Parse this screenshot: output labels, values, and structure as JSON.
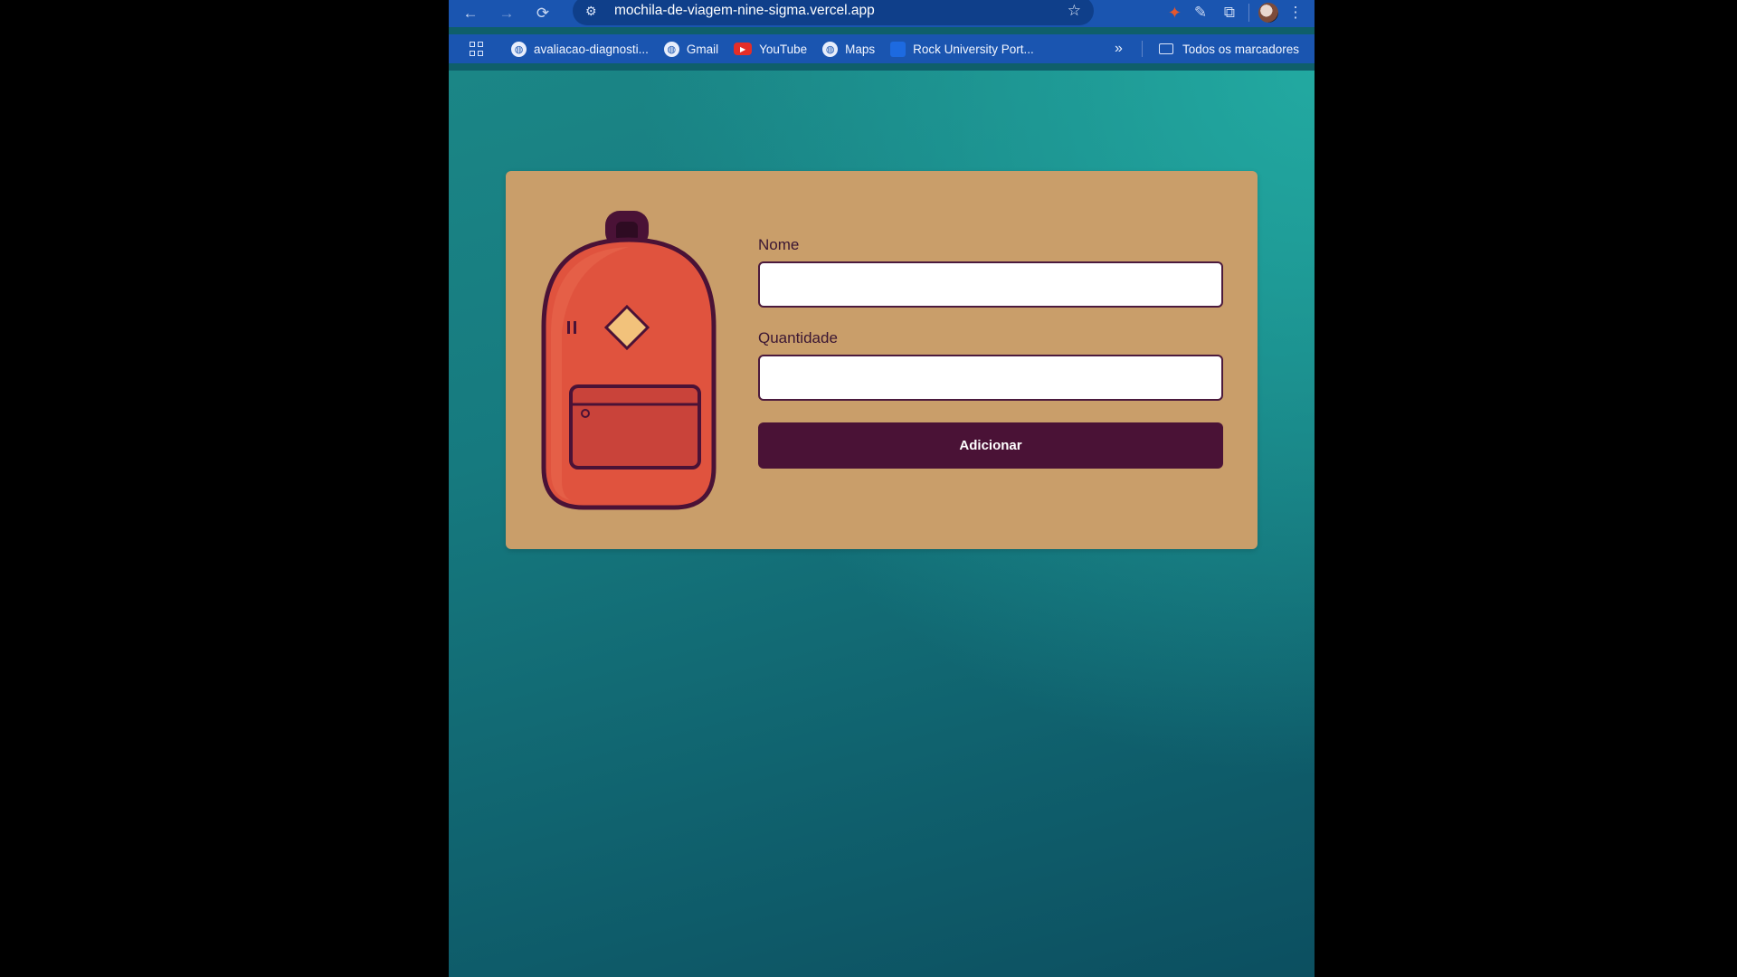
{
  "browser": {
    "url": "mochila-de-viagem-nine-sigma.vercel.app",
    "bookmarks": [
      {
        "label": "avaliacao-diagnosti...",
        "icon": "globe-icon"
      },
      {
        "label": "Gmail",
        "icon": "globe-icon"
      },
      {
        "label": "YouTube",
        "icon": "youtube-icon"
      },
      {
        "label": "Maps",
        "icon": "globe-icon"
      },
      {
        "label": "Rock University Port...",
        "icon": "rock-university-icon"
      }
    ],
    "all_bookmarks_label": "Todos os marcadores"
  },
  "form": {
    "name_label": "Nome",
    "name_value": "",
    "quantity_label": "Quantidade",
    "quantity_value": "",
    "submit_label": "Adicionar"
  },
  "colors": {
    "chrome_blue": "#1a55b0",
    "card": "#c99e6a",
    "button": "#4a1236",
    "backpack": "#e0533e"
  }
}
